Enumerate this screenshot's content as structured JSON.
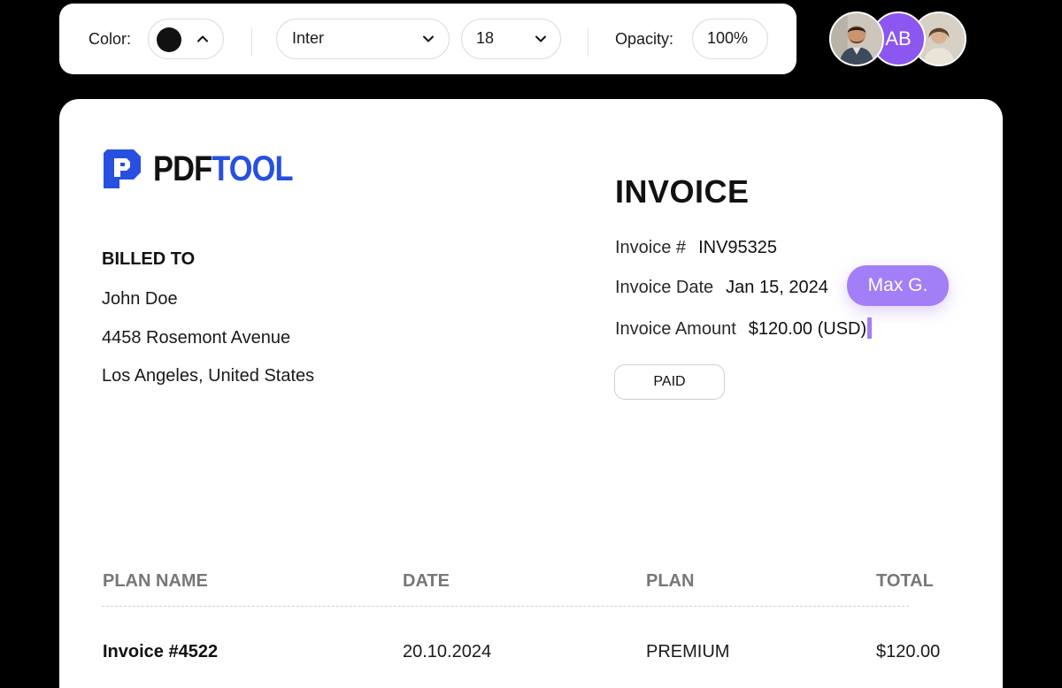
{
  "toolbar": {
    "color_label": "Color:",
    "color_value": "#111111",
    "font_value": "Inter",
    "size_value": "18",
    "opacity_label": "Opacity:",
    "opacity_value": "100%"
  },
  "collaborators": [
    {
      "type": "photo",
      "icon": "person-photo-icon"
    },
    {
      "type": "initials",
      "initials": "AB",
      "color": "#8b57f0"
    },
    {
      "type": "photo",
      "icon": "person-photo-icon"
    }
  ],
  "document": {
    "logo": {
      "part1": "PDF",
      "part2": "TOOL",
      "brand_color": "#2750e0"
    },
    "billed_to": {
      "heading": "BILLED TO",
      "name": "John Doe",
      "address": "4458 Rosemont Avenue",
      "city": "Los Angeles, United States"
    },
    "invoice": {
      "title": "INVOICE",
      "number_label": "Invoice #",
      "number_value": "INV95325",
      "date_label": "Invoice Date",
      "date_value": "Jan 15, 2024",
      "amount_label": "Invoice Amount",
      "amount_value": "$120.00 (USD)",
      "status": "PAID"
    },
    "cursor_tag": {
      "name": "Max G.",
      "color": "#a27ef7"
    },
    "table": {
      "headers": [
        "PLAN NAME",
        "DATE",
        "PLAN",
        "TOTAL"
      ],
      "rows": [
        [
          "Invoice #4522",
          "20.10.2024",
          "PREMIUM",
          "$120.00"
        ]
      ]
    }
  }
}
